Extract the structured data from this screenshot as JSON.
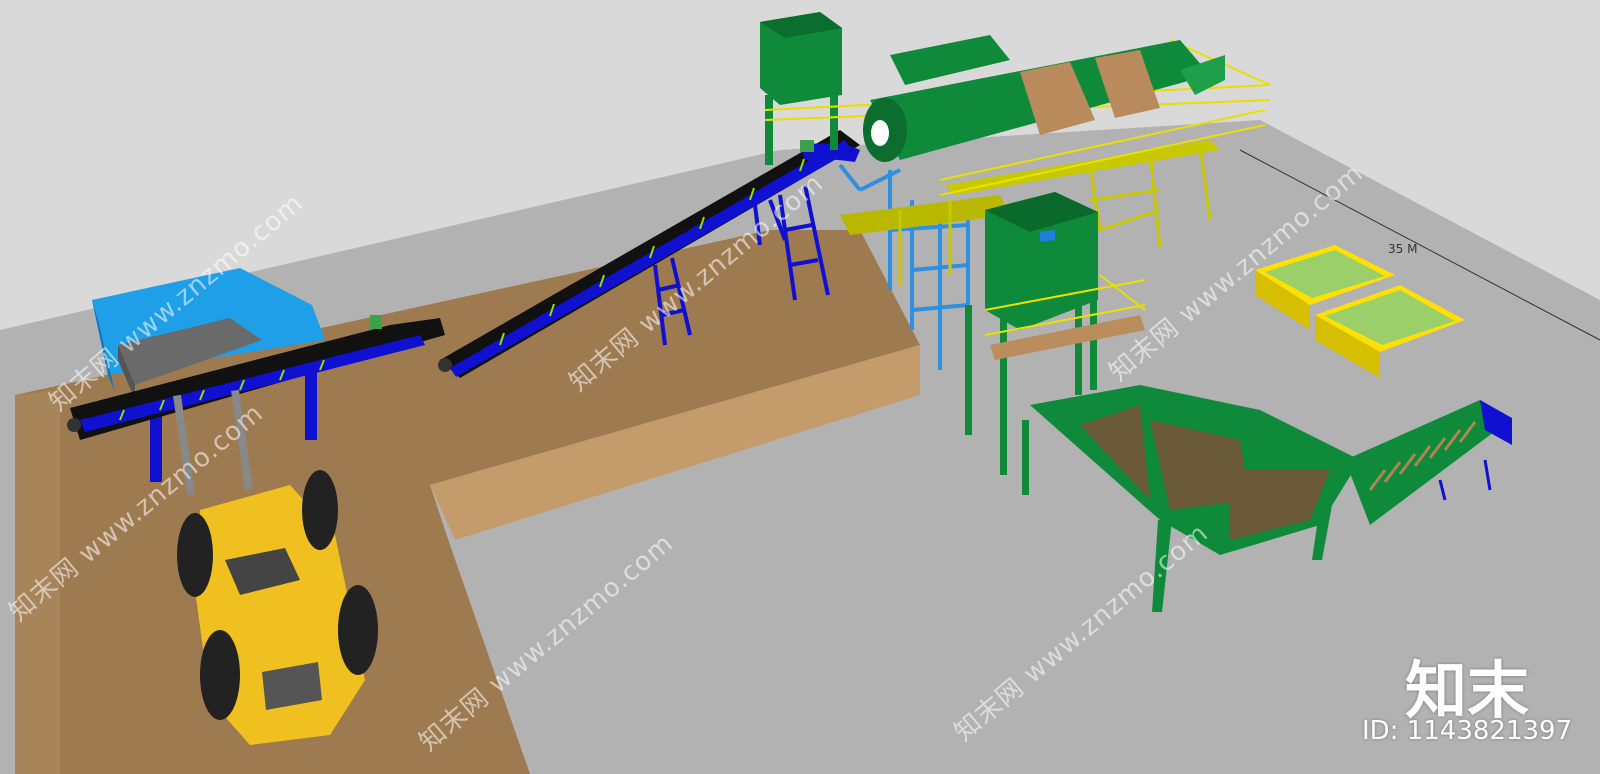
{
  "scene": {
    "dimension_label": "35 M",
    "colors": {
      "sky": "#d8d8d8",
      "ground": "#b3b3b3",
      "platform": "#a07b52",
      "platform_side": "#c09a6b",
      "feeder": "#1aa0e6",
      "conveyor_frame": "#1010d0",
      "belt": "#111111",
      "green_equipment": "#0e8a3a",
      "dark_green": "#0a6a2c",
      "yellow_structure": "#c8c800",
      "loader": "#f0c020",
      "tank": "#ffe000",
      "water": "#9bcf6a"
    }
  },
  "watermarks": {
    "text": "www.znzmo.com",
    "prefix": "知末网"
  },
  "brand": {
    "logo": "知末",
    "id": "ID: 1143821397"
  }
}
